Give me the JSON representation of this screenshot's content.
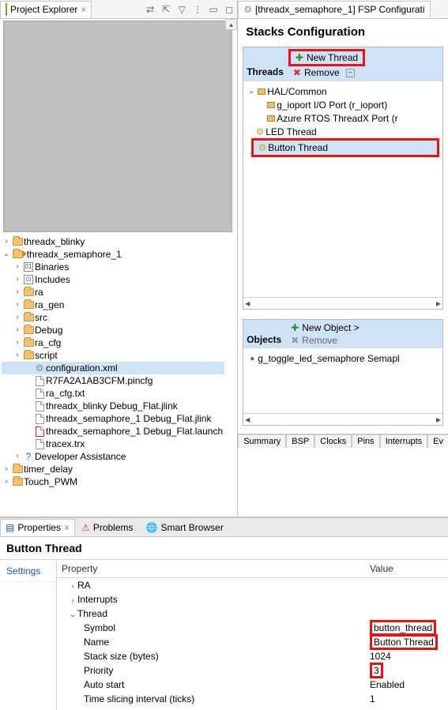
{
  "explorer": {
    "title": "Project Explorer",
    "toolbar_icons": [
      "link-icon",
      "collapse-icon",
      "filter-icon",
      "view-menu-icon",
      "minimize-icon",
      "maximize-icon"
    ],
    "tree": {
      "blinky": "threadx_blinky",
      "sem": "threadx_semaphore_1",
      "binaries": "Binaries",
      "includes": "Includes",
      "ra": "ra",
      "ra_gen": "ra_gen",
      "src": "src",
      "debug": "Debug",
      "ra_cfg": "ra_cfg",
      "script": "script",
      "cfgxml": "configuration.xml",
      "pincfg": "R7FA2A1AB3CFM.pincfg",
      "cfgtxt": "ra_cfg.txt",
      "jlink1": "threadx_blinky Debug_Flat.jlink",
      "jlink2": "threadx_semaphore_1 Debug_Flat.jlink",
      "launch": "threadx_semaphore_1 Debug_Flat.launch",
      "tracex": "tracex.trx",
      "devassist": "Developer Assistance",
      "timer": "timer_delay",
      "touch": "Touch_PWM"
    }
  },
  "fsp": {
    "tab_title": "[threadx_semaphore_1] FSP Configurati",
    "stacks_title": "Stacks Configuration",
    "threads": {
      "title": "Threads",
      "new": "New Thread",
      "remove": "Remove",
      "hal": "HAL/Common",
      "ioport": "g_ioport I/O Port (r_ioport)",
      "azure": "Azure RTOS ThreadX Port (r",
      "led": "LED Thread",
      "button": "Button Thread"
    },
    "objects": {
      "title": "Objects",
      "new": "New Object >",
      "remove": "Remove",
      "item": "g_toggle_led_semaphore Semapl"
    },
    "bottom_tabs": [
      "Summary",
      "BSP",
      "Clocks",
      "Pins",
      "Interrupts",
      "Ev"
    ]
  },
  "props": {
    "tabs": {
      "properties": "Properties",
      "problems": "Problems",
      "smart": "Smart Browser"
    },
    "title": "Button Thread",
    "side": "Settings",
    "header": {
      "prop": "Property",
      "val": "Value"
    },
    "rows": {
      "ra": "RA",
      "interrupts": "Interrupts",
      "thread": "Thread",
      "symbol": "Symbol",
      "name": "Name",
      "stack": "Stack size (bytes)",
      "priority": "Priority",
      "auto": "Auto start",
      "slice": "Time slicing interval (ticks)"
    },
    "vals": {
      "symbol": "button_thread",
      "name": "Button Thread",
      "stack": "1024",
      "priority": "3",
      "auto": "Enabled",
      "slice": "1"
    }
  }
}
